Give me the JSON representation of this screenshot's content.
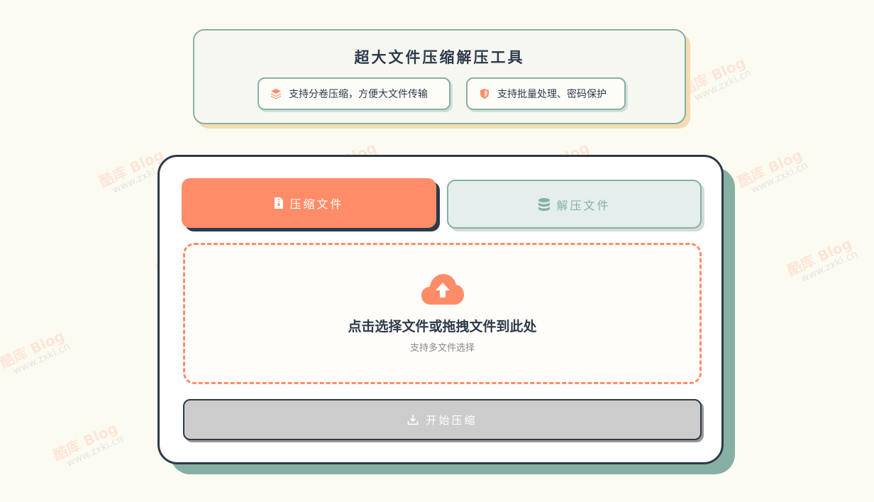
{
  "header": {
    "title": "超大文件压缩解压工具",
    "features": [
      {
        "icon": "layers-icon",
        "label": "支持分卷压缩，方便大文件传输"
      },
      {
        "icon": "shield-icon",
        "label": "支持批量处理、密码保护"
      }
    ]
  },
  "tabs": {
    "compress_label": "压缩文件",
    "decompress_label": "解压文件"
  },
  "dropzone": {
    "title": "点击选择文件或拖拽文件到此处",
    "subtitle": "支持多文件选择"
  },
  "action": {
    "start_label": "开始压缩"
  },
  "watermark": {
    "brand": "酷库 Blog",
    "url": "www.zxki.cn"
  },
  "colors": {
    "accent": "#ff8c69",
    "teal": "#86b0a4",
    "dark": "#2d3a4a",
    "background": "#fcfbf2",
    "disabled": "#cccccc"
  }
}
